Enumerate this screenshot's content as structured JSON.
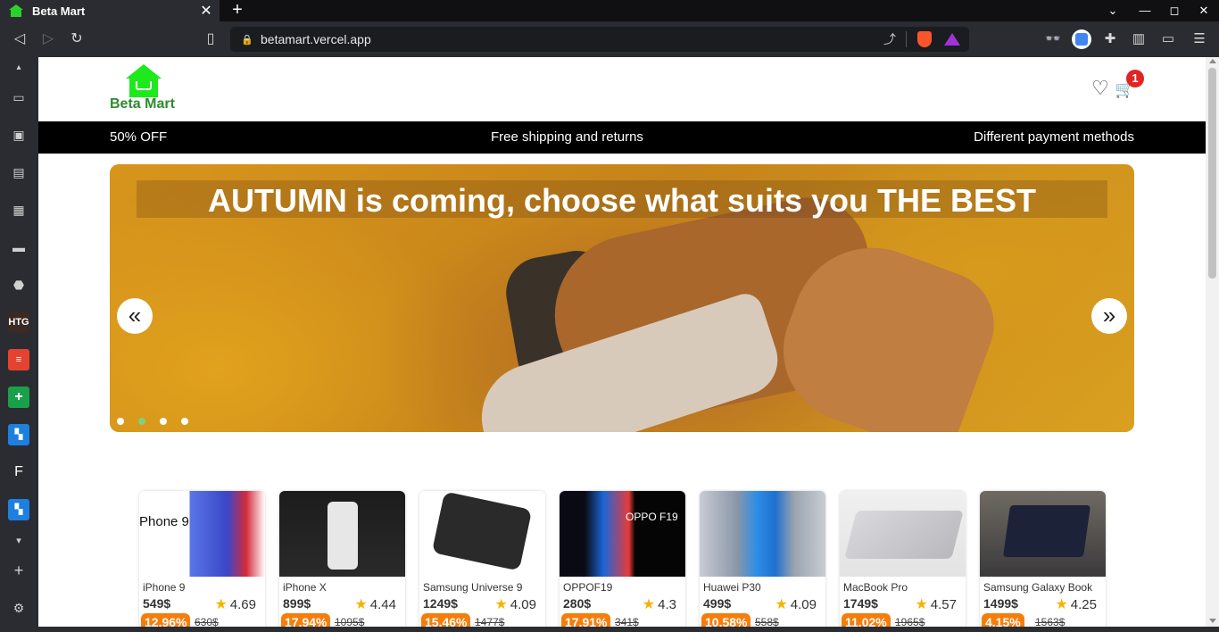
{
  "browser": {
    "tab": {
      "title": "Beta Mart",
      "close": "✕"
    },
    "new_tab": "+",
    "window": {
      "minimize": "—",
      "maximize": "◻",
      "close": "✕",
      "tab_list": "⌄"
    },
    "url": "betamart.vercel.app",
    "icons": {
      "back": "◁",
      "forward": "▷",
      "reload": "↻",
      "bookmark": "▯",
      "lock": "🔒",
      "share": "⤴",
      "extensions": "✚",
      "sidebar": "▥",
      "wallet": "▭",
      "menu": "☰",
      "incognito": "👓"
    }
  },
  "sidebar": {
    "items": [
      {
        "icon": "▴"
      },
      {
        "icon": "▭"
      },
      {
        "icon": "▣"
      },
      {
        "icon": "▤"
      },
      {
        "icon": "▦"
      },
      {
        "icon": "▬"
      },
      {
        "icon": "⬣"
      },
      {
        "icon": "HTG"
      },
      {
        "icon": "≡"
      },
      {
        "icon": "+"
      },
      {
        "icon": "▚"
      },
      {
        "icon": "F"
      },
      {
        "icon": "▚"
      },
      {
        "icon": "▾"
      },
      {
        "icon": "+"
      },
      {
        "icon": "⚙"
      }
    ]
  },
  "site": {
    "logo_text": "Beta Mart",
    "header": {
      "heart_icon": "♡",
      "cart_icon": "🛒",
      "cart_count": "1"
    },
    "promo": {
      "left": "50% OFF",
      "center": "Free shipping and returns",
      "right": "Different payment methods"
    },
    "hero": {
      "title": "AUTUMN is coming, choose what suits you THE BEST",
      "prev": "«",
      "next": "»",
      "slides": 4,
      "active_slide": 2
    },
    "products": [
      {
        "name": "iPhone 9",
        "price": "549$",
        "rating": "4.69",
        "discount": "12.96%",
        "old_price": "630$",
        "caption": "Phone 9"
      },
      {
        "name": "iPhone X",
        "price": "899$",
        "rating": "4.44",
        "discount": "17.94%",
        "old_price": "1095$",
        "caption": ""
      },
      {
        "name": "Samsung Universe 9",
        "price": "1249$",
        "rating": "4.09",
        "discount": "15.46%",
        "old_price": "1477$",
        "caption": ""
      },
      {
        "name": "OPPOF19",
        "price": "280$",
        "rating": "4.3",
        "discount": "17.91%",
        "old_price": "341$",
        "caption": "OPPO F19"
      },
      {
        "name": "Huawei P30",
        "price": "499$",
        "rating": "4.09",
        "discount": "10.58%",
        "old_price": "558$",
        "caption": ""
      },
      {
        "name": "MacBook Pro",
        "price": "1749$",
        "rating": "4.57",
        "discount": "11.02%",
        "old_price": "1965$",
        "caption": ""
      },
      {
        "name": "Samsung Galaxy Book",
        "price": "1499$",
        "rating": "4.25",
        "discount": "4.15%",
        "old_price": "1563$",
        "caption": ""
      }
    ],
    "star_icon": "★"
  },
  "colors": {
    "brand_green": "#1de91d",
    "logo_text": "#2e8b2e",
    "discount": "#f57e0b",
    "badge": "#e02424",
    "promo_bg": "#000000",
    "dot_active": "#7fd07f"
  }
}
